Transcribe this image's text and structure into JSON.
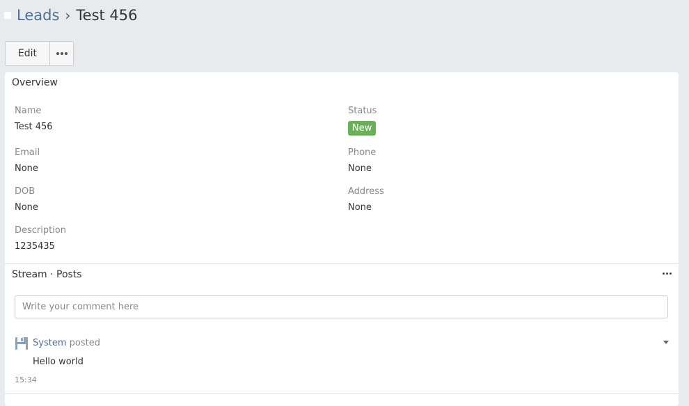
{
  "breadcrumb": {
    "parent": "Leads",
    "separator": "›",
    "current": "Test 456"
  },
  "toolbar": {
    "edit_label": "Edit",
    "more_icon": "ellipsis-icon"
  },
  "overview": {
    "title": "Overview",
    "fields": {
      "name": {
        "label": "Name",
        "value": "Test 456"
      },
      "status": {
        "label": "Status",
        "value": "New",
        "color": "#6aaf5a"
      },
      "email": {
        "label": "Email",
        "value": "None"
      },
      "phone": {
        "label": "Phone",
        "value": "None"
      },
      "dob": {
        "label": "DOB",
        "value": "None"
      },
      "address": {
        "label": "Address",
        "value": "None"
      },
      "description": {
        "label": "Description",
        "value": "1235435"
      }
    }
  },
  "stream": {
    "title": "Stream · Posts",
    "comment_placeholder": "Write your comment here",
    "posts": [
      {
        "author": "System",
        "action": "posted",
        "body": "Hello world",
        "time": "15:34",
        "icon": "system-avatar-icon"
      }
    ]
  },
  "colors": {
    "accent": "#4f6f96",
    "background": "#e8ebee",
    "status_new": "#6aaf5a"
  }
}
